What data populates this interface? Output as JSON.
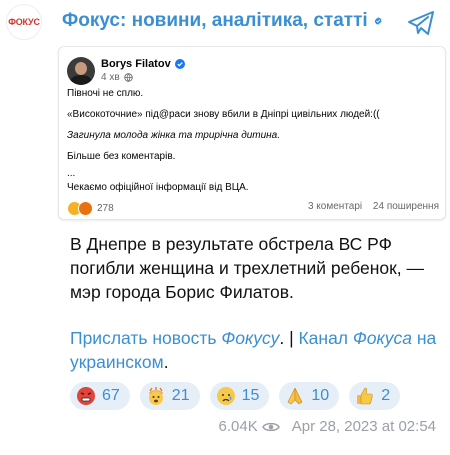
{
  "channel": {
    "avatar_label": "ФОКУС",
    "title": "Фокус: новини, аналітика, статті"
  },
  "fb_post": {
    "author": "Borys Filatov",
    "time": "4 хв",
    "lines": [
      "Півночі не сплю.",
      "«Високоточние» під@раси знову вбили в Дніпрі цивільних людей:((",
      "Загинула молода жінка та трирічна дитина.",
      "Більше без коментарів.",
      "...",
      "Чекаємо офіційної інформації від ВЦА."
    ],
    "reactions_count": "278",
    "comments": "3 коментарі",
    "shares": "24 поширення"
  },
  "message": {
    "headline": "В Днепре в результате обстрела ВС РФ погибли женщина и трехлетний ребенок, — мэр города Борис Филатов.",
    "link1_a": "Прислать новость ",
    "link1_b": "Фокусу",
    "separator": ". | ",
    "link2_a": "Канал ",
    "link2_b": "Фокуса",
    "link2_c": " на украинском",
    "end": "."
  },
  "reactions": [
    {
      "icon": "angry-face-icon",
      "count": "67"
    },
    {
      "icon": "exploding-head-icon",
      "count": "21"
    },
    {
      "icon": "crying-face-icon",
      "count": "15"
    },
    {
      "icon": "praying-hands-icon",
      "count": "10"
    },
    {
      "icon": "thumbs-up-icon",
      "count": "2"
    }
  ],
  "footer": {
    "views": "6.04K",
    "date": "Apr 28, 2023 at 02:54"
  },
  "colors": {
    "accent": "#3a8fd3",
    "brand_red": "#d6322a",
    "chip_bg": "#e6eff8"
  }
}
